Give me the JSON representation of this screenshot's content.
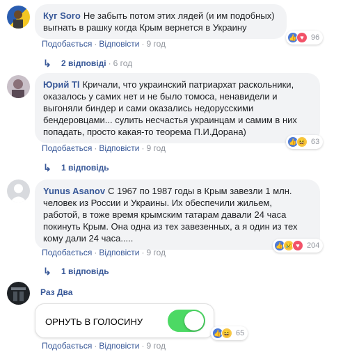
{
  "comments": [
    {
      "author": "Куг Soro",
      "text": "Не забыть потом этих лядей (и им подобных) выгнать в рашку когда Крым вернется в Украину",
      "like": "Подобається",
      "reply": "Відповісти",
      "time": "9 год",
      "reaction_count": "96",
      "replies_label": "2 відповіді",
      "replies_time": "6 год",
      "reactions": [
        "like",
        "love"
      ]
    },
    {
      "author": "Юрий Tl",
      "text": "Кричали, что украинский патриархат раскольники, оказалось у самих нет и не было томоса, ненавидели и выгоняли биндер и сами оказались недорусскими бендеровцами... сулить несчастья украинцам и самим в них попадать, просто какая-то теорема П.И.Дорана)",
      "like": "Подобається",
      "reply": "Відповісти",
      "time": "9 год",
      "reaction_count": "63",
      "replies_label": "1 відповідь",
      "reactions": [
        "like",
        "haha"
      ]
    },
    {
      "author": "Yunus Asanov",
      "text": "С 1967 по 1987 годы в Крым завезли 1 млн. человек из России и Украины. Их обеспечили жильем, работой, в тоже время крымским татарам давали 24 часа покинуть Крым. Она одна из тех завезенных, а я один из тех кому дали 24 часа.....",
      "like": "Подобається",
      "reply": "Відповісти",
      "time": "9 год",
      "reaction_count": "204",
      "replies_label": "1 відповідь",
      "reactions": [
        "like",
        "sad",
        "love"
      ]
    },
    {
      "author": "Раз Два",
      "sticker_text": "ОРНУТЬ В ГОЛОСИНУ",
      "like": "Подобається",
      "reply": "Відповісти",
      "time": "9 год",
      "reaction_count": "65",
      "reactions": [
        "like",
        "haha"
      ]
    }
  ],
  "icons": {
    "like": "thumbs-up-icon",
    "love": "heart-icon",
    "haha": "laughing-face-icon",
    "sad": "crying-face-icon",
    "reply_arrow": "reply-arrow-icon"
  },
  "colors": {
    "link": "#385898",
    "muted": "#90949c",
    "bubble": "#f2f3f5",
    "toggle_on": "#4cd964"
  }
}
